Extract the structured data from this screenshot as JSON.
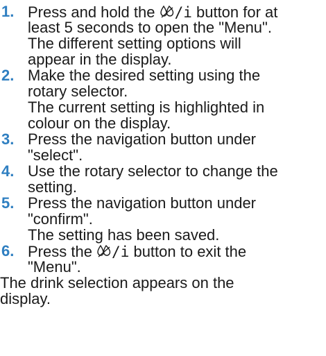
{
  "steps": [
    {
      "number": "1.",
      "lines": [
        {
          "before": "Press and hold the ",
          "symbol": true,
          "after": " button for at"
        },
        {
          "text": "least 5 seconds to open the \"Menu\"."
        },
        {
          "text": "The different setting options will"
        },
        {
          "text": "appear in the display."
        }
      ]
    },
    {
      "number": "2.",
      "lines": [
        {
          "text": "Make the desired setting using the"
        },
        {
          "text": "rotary selector."
        },
        {
          "text": "The current setting is highlighted in"
        },
        {
          "text": "colour on the display."
        }
      ]
    },
    {
      "number": "3.",
      "lines": [
        {
          "text": "Press the navigation button under"
        },
        {
          "text": "\"select\"."
        }
      ]
    },
    {
      "number": "4.",
      "lines": [
        {
          "text": "Use the rotary selector to change the"
        },
        {
          "text": "setting."
        }
      ]
    },
    {
      "number": "5.",
      "lines": [
        {
          "text": "Press the navigation button under"
        },
        {
          "text": "\"confirm\"."
        },
        {
          "text": "The setting has been saved."
        }
      ]
    },
    {
      "number": "6.",
      "lines": [
        {
          "before": "Press the ",
          "symbol": true,
          "after": " button to exit the"
        },
        {
          "text": "\"Menu\"."
        }
      ]
    }
  ],
  "symbol": {
    "icon": "drops-info-icon",
    "glyph_suffix": "/i"
  },
  "footer": [
    "The drink selection appears on the",
    "display."
  ],
  "colors": {
    "step_number": "#2f7fc1",
    "text": "#1a1a1a"
  }
}
